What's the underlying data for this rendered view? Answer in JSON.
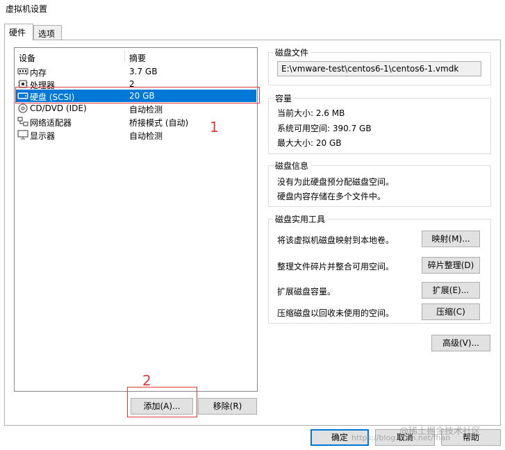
{
  "window": {
    "title": "虚拟机设置"
  },
  "tabs": [
    {
      "label": "硬件"
    },
    {
      "label": "选项"
    }
  ],
  "device_list": {
    "headers": {
      "device": "设备",
      "summary": "摘要"
    },
    "rows": [
      {
        "icon": "memory-icon",
        "name": "内存",
        "summary": "3.7 GB"
      },
      {
        "icon": "processor-icon",
        "name": "处理器",
        "summary": "2"
      },
      {
        "icon": "hard-disk-icon",
        "name": "硬盘 (SCSI)",
        "summary": "20 GB",
        "selected": true
      },
      {
        "icon": "cd-dvd-icon",
        "name": "CD/DVD (IDE)",
        "summary": "自动检测"
      },
      {
        "icon": "network-adapter-icon",
        "name": "网络适配器",
        "summary": "桥接模式 (自动)"
      },
      {
        "icon": "display-icon",
        "name": "显示器",
        "summary": "自动检测"
      }
    ],
    "add_button": "添加(A)...",
    "remove_button": "移除(R)"
  },
  "annotations": {
    "label_1": "1",
    "label_2": "2",
    "color": "#e03a3a"
  },
  "disk_file": {
    "title": "磁盘文件",
    "path": "E:\\vmware-test\\centos6-1\\centos6-1.vmdk"
  },
  "capacity": {
    "title": "容量",
    "current_size": "当前大小: 2.6 MB",
    "system_free": "系统可用空间: 390.7 GB",
    "max_size": "最大大小: 20 GB"
  },
  "disk_info": {
    "title": "磁盘信息",
    "line1": "没有为此硬盘预分配磁盘空间。",
    "line2": "硬盘内容存储在多个文件中。"
  },
  "disk_utilities": {
    "title": "磁盘实用工具",
    "items": [
      {
        "text": "将该虚拟机磁盘映射到本地卷。",
        "button": "映射(M)..."
      },
      {
        "text": "整理文件碎片并整合可用空间。",
        "button": "碎片整理(D)"
      },
      {
        "text": "扩展磁盘容量。",
        "button": "扩展(E)..."
      },
      {
        "text": "压缩磁盘以回收未使用的空间。",
        "button": "压缩(C)"
      }
    ]
  },
  "advanced_button": "高级(V)...",
  "footer": {
    "ok": "确定",
    "cancel": "取消",
    "help": "帮助"
  },
  "watermark": {
    "text1": "@稀土掘金技术社区",
    "text2": "https://blog.csdn.net/fhan"
  },
  "colors": {
    "selection": "#0078d7",
    "annotation": "#e03a3a"
  }
}
